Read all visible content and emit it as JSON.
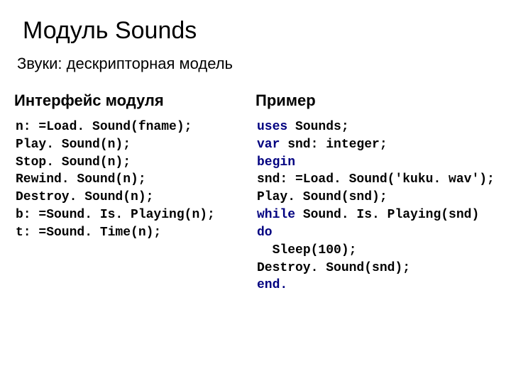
{
  "title": "Модуль Sounds",
  "subtitle": "Звуки: дескрипторная модель",
  "left": {
    "heading": "Интерфейс модуля",
    "lines": [
      "n: =Load. Sound(fname);",
      "Play. Sound(n);",
      "Stop. Sound(n);",
      "Rewind. Sound(n);",
      "Destroy. Sound(n);",
      "b: =Sound. Is. Playing(n);",
      "t: =Sound. Time(n);"
    ]
  },
  "right": {
    "heading": "Пример",
    "lines": [
      {
        "segments": [
          {
            "t": "uses",
            "kw": true
          },
          {
            "t": " Sounds;"
          }
        ]
      },
      {
        "segments": [
          {
            "t": "var",
            "kw": true
          },
          {
            "t": " snd: integer;"
          }
        ]
      },
      {
        "segments": [
          {
            "t": "begin",
            "kw": true
          }
        ]
      },
      {
        "segments": [
          {
            "t": "snd: =Load. Sound('kuku. wav');"
          }
        ]
      },
      {
        "segments": [
          {
            "t": "Play. Sound(snd);"
          }
        ]
      },
      {
        "segments": [
          {
            "t": "while",
            "kw": true
          },
          {
            "t": " Sound. Is. Playing(snd) "
          },
          {
            "t": "do",
            "kw": true
          }
        ]
      },
      {
        "segments": [
          {
            "t": "  Sleep(100);"
          }
        ]
      },
      {
        "segments": [
          {
            "t": "Destroy. Sound(snd);"
          }
        ]
      },
      {
        "segments": [
          {
            "t": "end.",
            "kw": true
          }
        ]
      }
    ]
  }
}
